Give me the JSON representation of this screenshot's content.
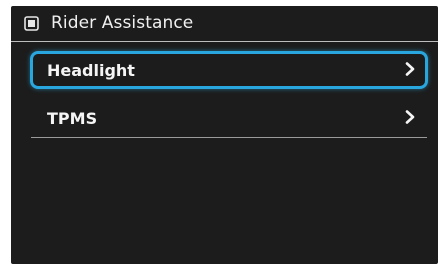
{
  "header": {
    "title": "Rider Assistance",
    "icon": "chip-icon"
  },
  "menu": {
    "items": [
      {
        "label": "Headlight",
        "icon": "chevron-right-icon",
        "selected": true
      },
      {
        "label": "TPMS",
        "icon": "chevron-right-icon",
        "selected": false
      }
    ]
  },
  "colors": {
    "background": "#1c1c1c",
    "accent": "#2aa6df",
    "text": "#f5f5f5"
  }
}
